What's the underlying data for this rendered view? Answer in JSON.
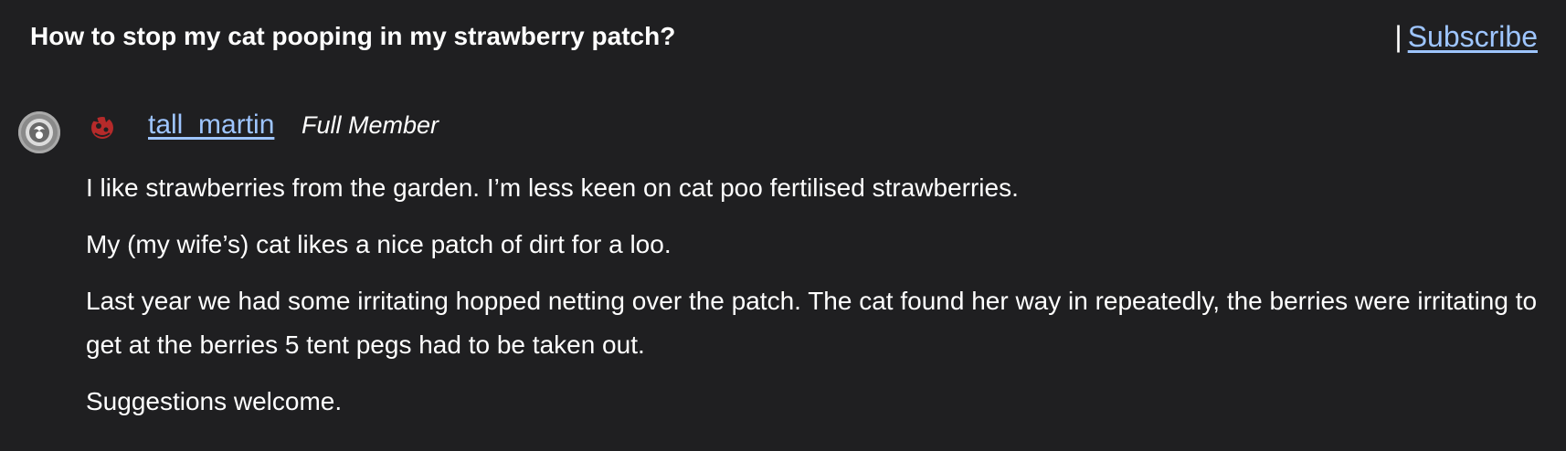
{
  "thread": {
    "title": "How to stop my cat pooping in my strawberry patch?",
    "separator": "|",
    "subscribe_label": "Subscribe"
  },
  "post": {
    "author": {
      "name": "tall_martin",
      "rank": "Full Member",
      "avatar_icon": "user-avatar-icon",
      "badge_icon": "member-badge-icon"
    },
    "paragraphs": [
      "I like strawberries from the garden. I’m less keen on cat poo fertilised strawberries.",
      "My (my wife’s) cat likes a nice patch of dirt for a loo.",
      "Last year we had some irritating hopped netting over the patch. The cat found her way in repeatedly, the berries were irritating to get at the berries 5 tent pegs had to be taken out.",
      "Suggestions welcome."
    ]
  },
  "colors": {
    "background": "#1f1f21",
    "text": "#ffffff",
    "link": "#9ec5ff",
    "badge_red": "#b52a2a"
  }
}
